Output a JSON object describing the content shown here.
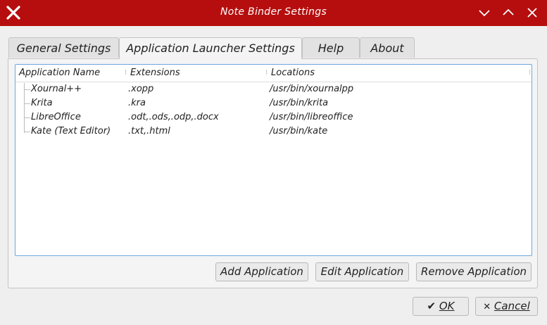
{
  "window": {
    "title": "Note Binder Settings"
  },
  "tabs": [
    {
      "label": "General Settings"
    },
    {
      "label": "Application Launcher Settings"
    },
    {
      "label": "Help"
    },
    {
      "label": "About"
    }
  ],
  "table": {
    "columns": [
      "Application Name",
      "Extensions",
      "Locations"
    ],
    "rows": [
      {
        "name": "Xournal++",
        "ext": ".xopp",
        "loc": "/usr/bin/xournalpp"
      },
      {
        "name": "Krita",
        "ext": ".kra",
        "loc": "/usr/bin/krita"
      },
      {
        "name": "LibreOffice",
        "ext": ".odt,.ods,.odp,.docx",
        "loc": "/usr/bin/libreoffice"
      },
      {
        "name": "Kate (Text Editor)",
        "ext": ".txt,.html",
        "loc": "/usr/bin/kate"
      }
    ]
  },
  "buttons": {
    "add": "Add Application",
    "edit": "Edit Application",
    "remove": "Remove Application",
    "ok": "OK",
    "cancel": "Cancel"
  },
  "icons": {
    "app": "x-close-icon",
    "minimize": "chevron-down-icon",
    "maximize": "chevron-up-icon",
    "close": "close-icon",
    "ok": "checkmark-icon",
    "cancel": "cross-icon"
  },
  "colors": {
    "titlebar": "#b60e0e",
    "focus_border": "#6fa6dc"
  }
}
